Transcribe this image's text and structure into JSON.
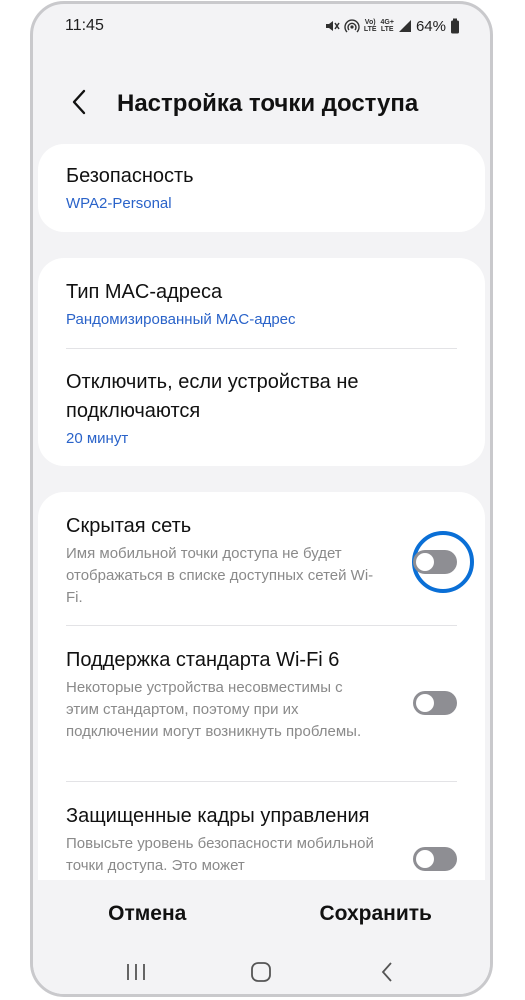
{
  "status_bar": {
    "time": "11:45",
    "battery_percent": "64%",
    "volte_label": "Vo))\nLTE",
    "network_label": "4G+\nLTE"
  },
  "header": {
    "title": "Настройка точки доступа"
  },
  "security": {
    "title": "Безопасность",
    "value": "WPA2-Personal"
  },
  "mac": {
    "title": "Тип MAC-адреса",
    "value": "Рандомизированный MAC-адрес"
  },
  "timeout": {
    "title": "Отключить, если устройства не подключаются",
    "value": "20 минут"
  },
  "hidden_network": {
    "title": "Скрытая сеть",
    "description": "Имя мобильной точки доступа не будет отображаться в списке доступных сетей Wi-Fi.",
    "enabled": false
  },
  "wifi6": {
    "title": "Поддержка стандарта Wi-Fi 6",
    "description": "Некоторые устройства несовместимы с этим стандартом, поэтому при их подключении могут возникнуть проблемы.",
    "enabled": false
  },
  "pmf": {
    "title": "Защищенные кадры управления",
    "description": "Повысьте уровень безопасности мобильной точки доступа. Это может",
    "enabled": false
  },
  "actions": {
    "cancel_label": "Отмена",
    "save_label": "Сохранить"
  },
  "colors": {
    "accent": "#2a63c9",
    "highlight": "#0a6fd6",
    "toggle_off": "#8e8e93"
  }
}
